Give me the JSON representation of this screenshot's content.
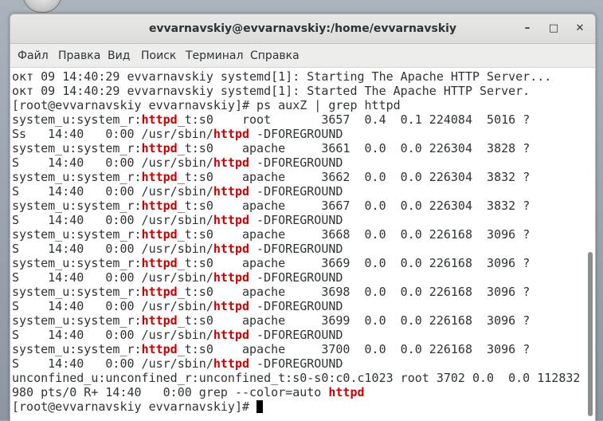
{
  "window": {
    "title": "evvarnavskiy@evvarnavskiy:/home/evvarnavskiy",
    "minimize_glyph": "–",
    "maximize_glyph": "□",
    "close_glyph": "✕"
  },
  "menu": [
    "Файл",
    "Правка",
    "Вид",
    "Поиск",
    "Терминал",
    "Справка"
  ],
  "terminal": {
    "lines": [
      [
        {
          "t": "окт 09 14:40:29 evvarnavskiy systemd[1]: Starting The Apache HTTP Server..."
        }
      ],
      [
        {
          "t": "окт 09 14:40:29 evvarnavskiy systemd[1]: Started The Apache HTTP Server."
        }
      ],
      [
        {
          "t": "[root@evvarnavskiy evvarnavskiy]# ps auxZ | grep httpd"
        }
      ],
      [
        {
          "t": "system_u:system_r:"
        },
        {
          "t": "httpd",
          "hl": true
        },
        {
          "t": "_t:s0    root       3657  0.4  0.1 224084  5016 ?"
        }
      ],
      [
        {
          "t": "Ss   14:40   0:00 /usr/sbin/"
        },
        {
          "t": "httpd",
          "hl": true
        },
        {
          "t": " -DFOREGROUND"
        }
      ],
      [
        {
          "t": "system_u:system_r:"
        },
        {
          "t": "httpd",
          "hl": true
        },
        {
          "t": "_t:s0    apache     3661  0.0  0.0 226304  3828 ?"
        }
      ],
      [
        {
          "t": "S    14:40   0:00 /usr/sbin/"
        },
        {
          "t": "httpd",
          "hl": true
        },
        {
          "t": " -DFOREGROUND"
        }
      ],
      [
        {
          "t": "system_u:system_r:"
        },
        {
          "t": "httpd",
          "hl": true
        },
        {
          "t": "_t:s0    apache     3662  0.0  0.0 226304  3832 ?"
        }
      ],
      [
        {
          "t": "S    14:40   0:00 /usr/sbin/"
        },
        {
          "t": "httpd",
          "hl": true
        },
        {
          "t": " -DFOREGROUND"
        }
      ],
      [
        {
          "t": "system_u:system_r:"
        },
        {
          "t": "httpd",
          "hl": true
        },
        {
          "t": "_t:s0    apache     3667  0.0  0.0 226304  3832 ?"
        }
      ],
      [
        {
          "t": "S    14:40   0:00 /usr/sbin/"
        },
        {
          "t": "httpd",
          "hl": true
        },
        {
          "t": " -DFOREGROUND"
        }
      ],
      [
        {
          "t": "system_u:system_r:"
        },
        {
          "t": "httpd",
          "hl": true
        },
        {
          "t": "_t:s0    apache     3668  0.0  0.0 226168  3096 ?"
        }
      ],
      [
        {
          "t": "S    14:40   0:00 /usr/sbin/"
        },
        {
          "t": "httpd",
          "hl": true
        },
        {
          "t": " -DFOREGROUND"
        }
      ],
      [
        {
          "t": "system_u:system_r:"
        },
        {
          "t": "httpd",
          "hl": true
        },
        {
          "t": "_t:s0    apache     3669  0.0  0.0 226168  3096 ?"
        }
      ],
      [
        {
          "t": "S    14:40   0:00 /usr/sbin/"
        },
        {
          "t": "httpd",
          "hl": true
        },
        {
          "t": " -DFOREGROUND"
        }
      ],
      [
        {
          "t": "system_u:system_r:"
        },
        {
          "t": "httpd",
          "hl": true
        },
        {
          "t": "_t:s0    apache     3698  0.0  0.0 226168  3096 ?"
        }
      ],
      [
        {
          "t": "S    14:40   0:00 /usr/sbin/"
        },
        {
          "t": "httpd",
          "hl": true
        },
        {
          "t": " -DFOREGROUND"
        }
      ],
      [
        {
          "t": "system_u:system_r:"
        },
        {
          "t": "httpd",
          "hl": true
        },
        {
          "t": "_t:s0    apache     3699  0.0  0.0 226168  3096 ?"
        }
      ],
      [
        {
          "t": "S    14:40   0:00 /usr/sbin/"
        },
        {
          "t": "httpd",
          "hl": true
        },
        {
          "t": " -DFOREGROUND"
        }
      ],
      [
        {
          "t": "system_u:system_r:"
        },
        {
          "t": "httpd",
          "hl": true
        },
        {
          "t": "_t:s0    apache     3700  0.0  0.0 226168  3096 ?"
        }
      ],
      [
        {
          "t": "S    14:40   0:00 /usr/sbin/"
        },
        {
          "t": "httpd",
          "hl": true
        },
        {
          "t": " -DFOREGROUND"
        }
      ],
      [
        {
          "t": "unconfined_u:unconfined_r:unconfined_t:s0-s0:c0.c1023 root 3702 0.0  0.0 112832"
        }
      ],
      [
        {
          "t": "980 pts/0 R+ 14:40   0:00 grep --color=auto "
        },
        {
          "t": "httpd",
          "hl": true
        }
      ],
      [
        {
          "t": "[root@evvarnavskiy evvarnavskiy]# "
        },
        {
          "cursor": true
        }
      ]
    ]
  },
  "colors": {
    "highlight": "#cc0000",
    "text": "#2e3436",
    "background": "#ffffff"
  }
}
